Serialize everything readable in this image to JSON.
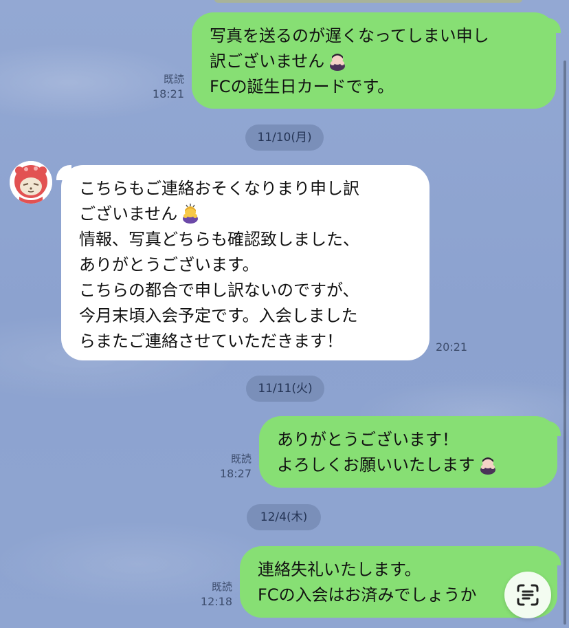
{
  "messages": [
    {
      "sender": "me",
      "lines": [
        "写真を送るのが遅くなってしまい申し",
        "訳ございません",
        "FCの誕生日カードです。"
      ],
      "emoji": "person-bowing-icon",
      "read": "既読",
      "time": "18:21"
    },
    {
      "date": "11/10(月)"
    },
    {
      "sender": "other",
      "lines": [
        "こちらもご連絡おそくなりまり申し訳",
        "ございません",
        "情報、写真どちらも確認致しました、",
        "ありがとうございます。",
        "こちらの都合で申し訳ないのですが、",
        "今月末頃入会予定です。入会しました",
        "らまたご連絡させていただきます！"
      ],
      "emoji": "person-bowing-icon",
      "time": "20:21"
    },
    {
      "date": "11/11(火)"
    },
    {
      "sender": "me",
      "lines": [
        "ありがとうございます！",
        "よろしくお願いいたします"
      ],
      "emoji": "person-bowing-icon",
      "read": "既読",
      "time": "18:27"
    },
    {
      "date": "12/4(木)"
    },
    {
      "sender": "me",
      "lines": [
        "連絡失礼いたします。",
        "FCの入会はお済みでしょうか"
      ],
      "read": "既読",
      "time": "12:18"
    }
  ],
  "colors": {
    "me_bubble": "#87df74",
    "other_bubble": "#ffffff",
    "background": "#8da4d1",
    "date_pill": "#7a8fb9"
  },
  "icons": {
    "avatar": "red-hood-character-avatar",
    "scan": "text-scan-icon"
  }
}
